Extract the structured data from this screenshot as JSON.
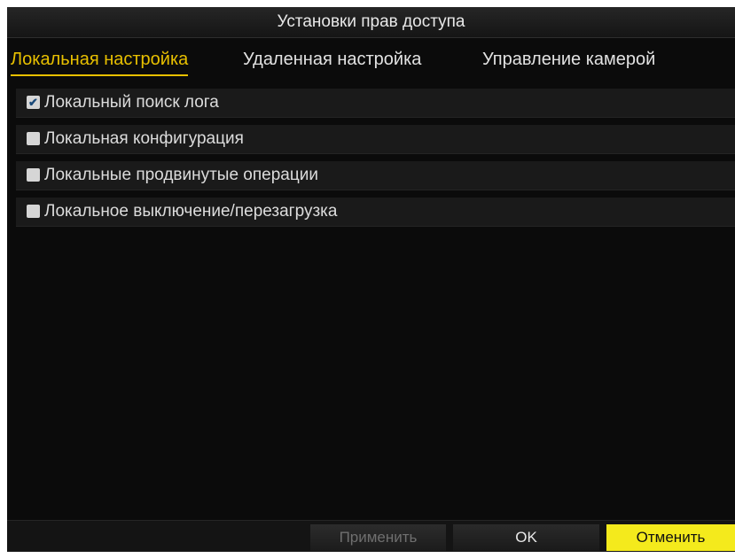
{
  "dialog": {
    "title": "Установки прав доступа"
  },
  "tabs": [
    {
      "label": "Локальная настройка",
      "active": true
    },
    {
      "label": "Удаленная настройка",
      "active": false
    },
    {
      "label": "Управление камерой",
      "active": false
    }
  ],
  "permissions": [
    {
      "label": "Локальный поиск лога",
      "checked": true
    },
    {
      "label": "Локальная конфигурация",
      "checked": false
    },
    {
      "label": "Локальные продвинутые операции",
      "checked": false
    },
    {
      "label": "Локальное выключение/перезагрузка",
      "checked": false
    }
  ],
  "buttons": {
    "apply": "Применить",
    "ok": "OK",
    "cancel": "Отменить"
  },
  "colors": {
    "active_tab": "#e8c000",
    "cancel_button": "#f4ea1c",
    "background": "#0b0b0b"
  }
}
